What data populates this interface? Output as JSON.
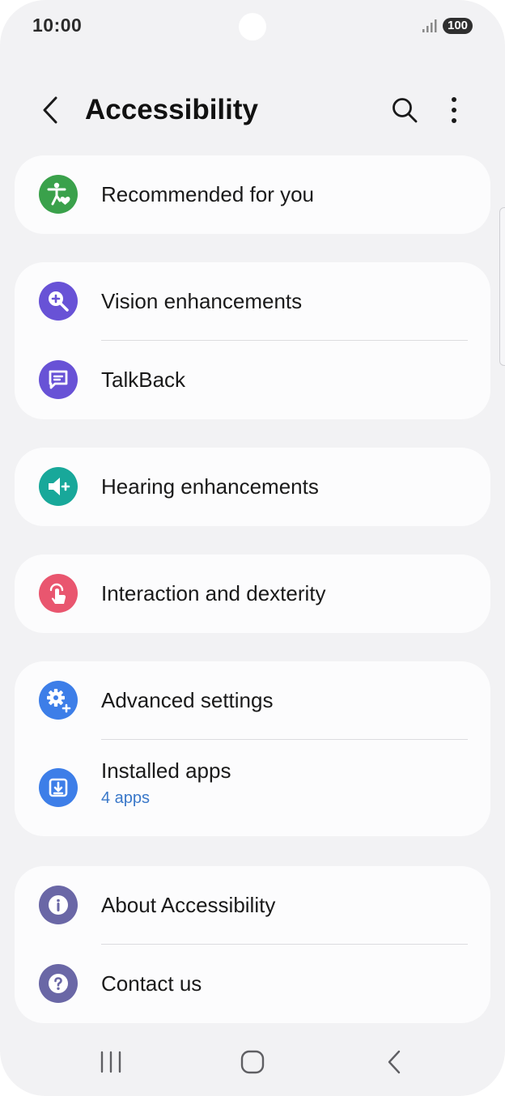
{
  "status_bar": {
    "time": "10:00",
    "battery": "100"
  },
  "app_bar": {
    "title": "Accessibility",
    "icons": [
      "back-arrow-icon",
      "search-icon",
      "more-options-icon"
    ]
  },
  "groups": [
    {
      "items": [
        {
          "label": "Recommended for you",
          "icon": "accessibility-person-icon",
          "color": "#3aa14b"
        }
      ]
    },
    {
      "items": [
        {
          "label": "Vision enhancements",
          "icon": "magnifier-plus-icon",
          "color": "#6852d6"
        },
        {
          "label": "TalkBack",
          "icon": "chat-bubble-icon",
          "color": "#6852d6"
        }
      ]
    },
    {
      "items": [
        {
          "label": "Hearing enhancements",
          "icon": "speaker-plus-icon",
          "color": "#18a89a"
        }
      ]
    },
    {
      "items": [
        {
          "label": "Interaction and dexterity",
          "icon": "touch-hand-icon",
          "color": "#e9566f"
        }
      ]
    },
    {
      "items": [
        {
          "label": "Advanced settings",
          "icon": "gear-plus-icon",
          "color": "#3d7ee8"
        },
        {
          "label": "Installed apps",
          "sub": "4 apps",
          "icon": "download-box-icon",
          "color": "#3d7ee8"
        }
      ]
    },
    {
      "items": [
        {
          "label": "About Accessibility",
          "icon": "info-icon",
          "color": "#6a67a6"
        },
        {
          "label": "Contact us",
          "icon": "question-icon",
          "color": "#6a67a6"
        }
      ]
    }
  ],
  "nav_bar": {
    "icons": [
      "recents-icon",
      "home-icon",
      "back-icon"
    ]
  }
}
